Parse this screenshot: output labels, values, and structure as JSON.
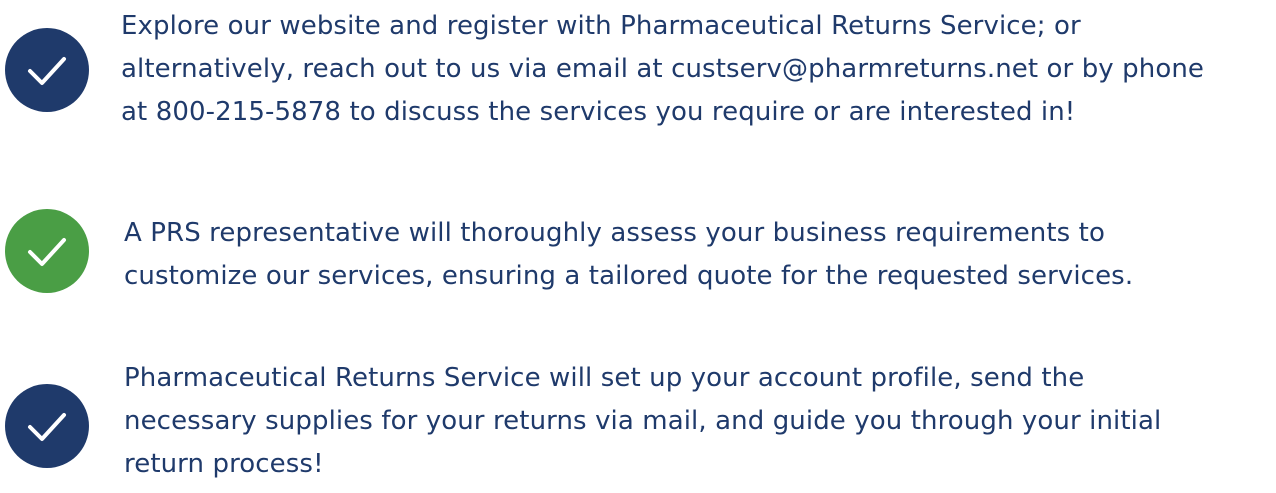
{
  "colors": {
    "navy": "#1f3a6b",
    "green": "#4a9e45",
    "text": "#1f3a6b"
  },
  "steps": [
    {
      "icon": "checkmark-icon",
      "badge_color": "navy",
      "lines": [
        "Explore our website and register with Pharmaceutical Returns Service; or",
        "alternatively, reach out to us via email at custserv@pharmreturns.net or by phone",
        "at 800-215-5878 to discuss the services you require or are interested in!"
      ]
    },
    {
      "icon": "checkmark-icon",
      "badge_color": "green",
      "lines": [
        "A PRS representative will thoroughly assess your business requirements to",
        "customize our services, ensuring a tailored quote for the requested services."
      ]
    },
    {
      "icon": "checkmark-icon",
      "badge_color": "navy",
      "lines": [
        "Pharmaceutical Returns Service will set up your account profile, send the",
        "necessary supplies for your returns via mail, and guide you through your initial",
        "return process!"
      ]
    }
  ]
}
